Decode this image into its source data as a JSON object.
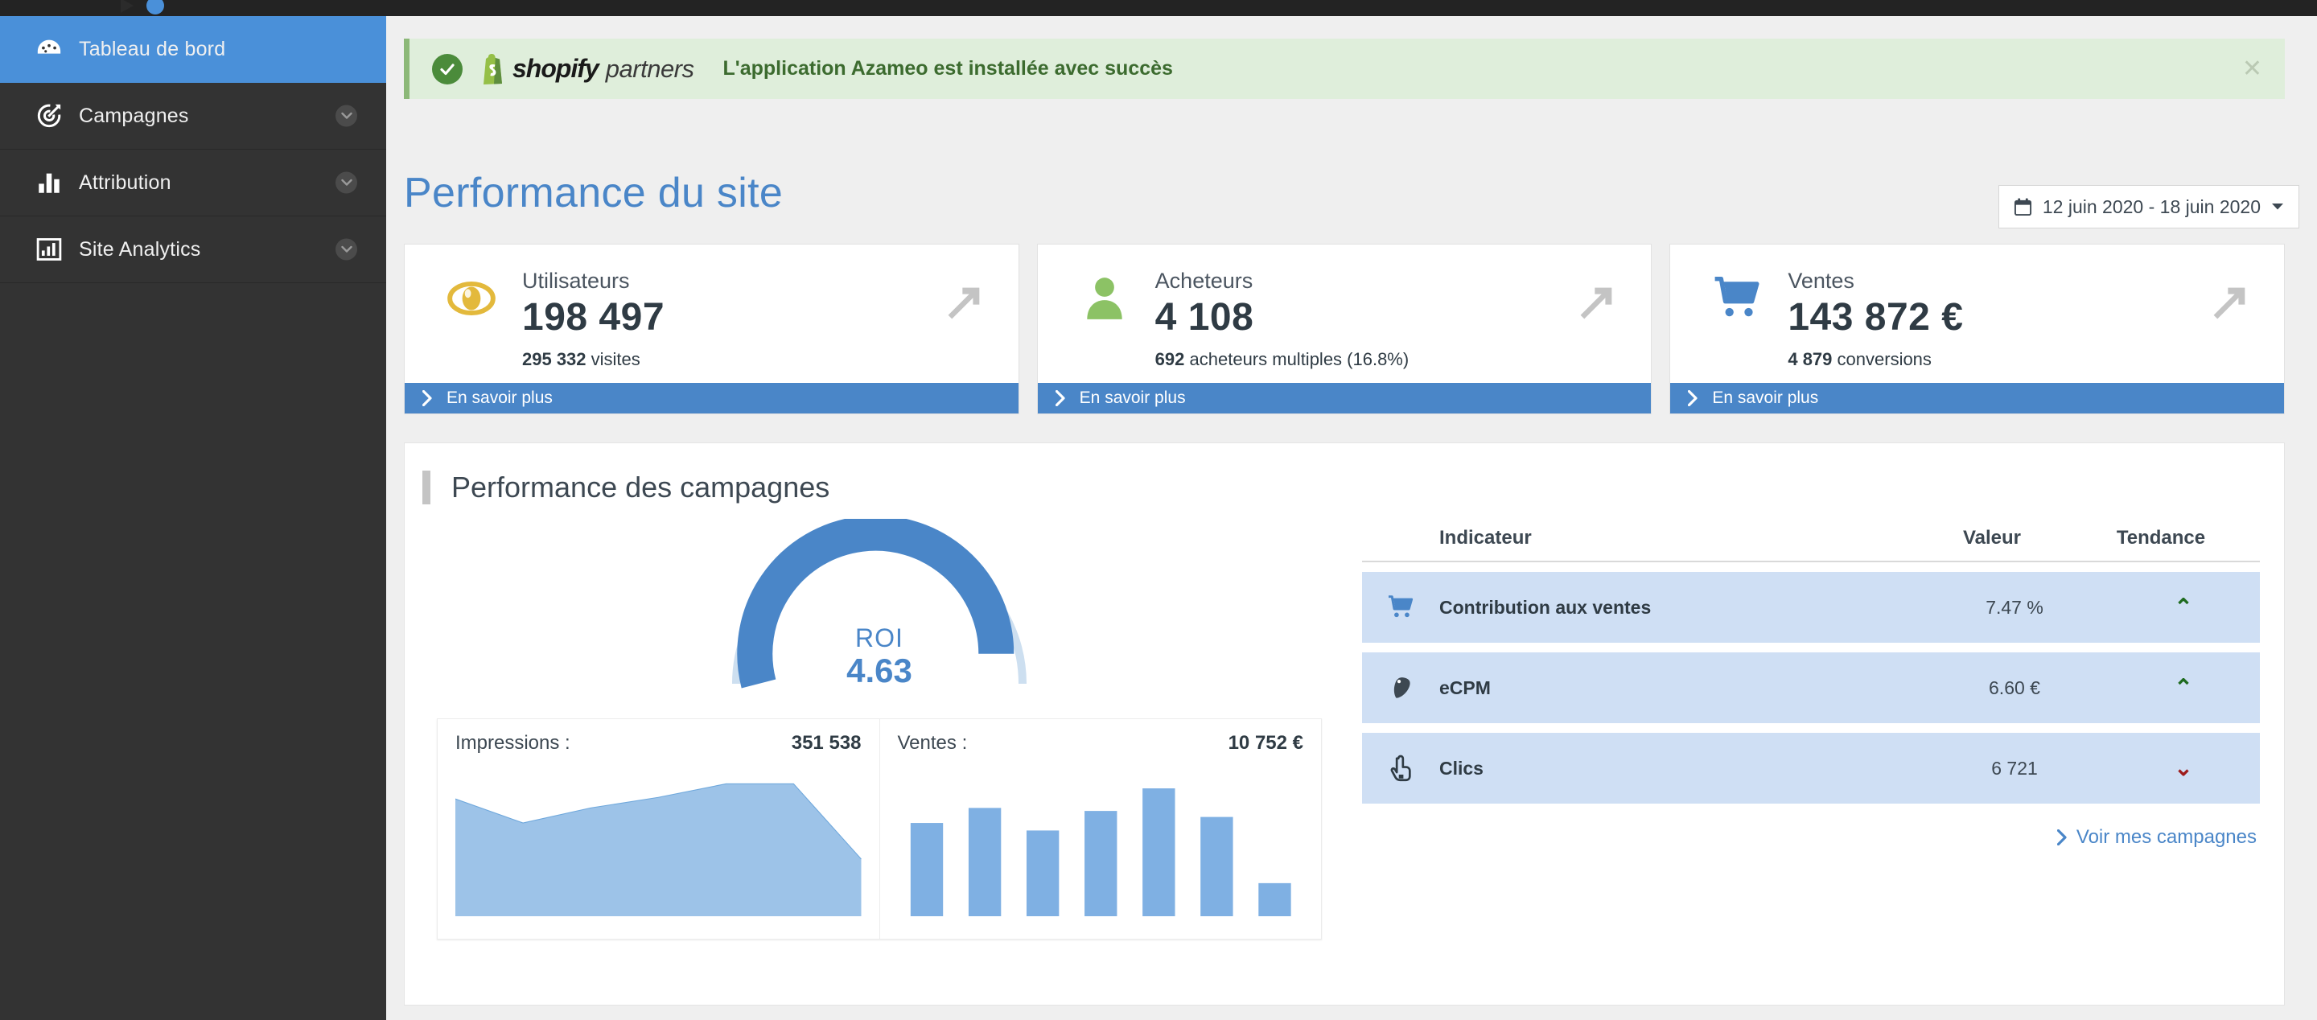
{
  "sidebar": {
    "items": [
      {
        "label": "Tableau de bord",
        "icon": "dashboard-gauge-icon",
        "active": true,
        "has_chevron": false
      },
      {
        "label": "Campagnes",
        "icon": "target-arrow-icon",
        "active": false,
        "has_chevron": true
      },
      {
        "label": "Attribution",
        "icon": "bar-chart-icon",
        "active": false,
        "has_chevron": true
      },
      {
        "label": "Site Analytics",
        "icon": "analytics-box-icon",
        "active": false,
        "has_chevron": true
      }
    ]
  },
  "banner": {
    "brand_primary": "shopify",
    "brand_secondary": "partners",
    "message": "L'application Azameo est installée avec succès",
    "close_label": "✕",
    "accent": "#8cb878",
    "background": "#dfeedb",
    "text_color": "#3c6b2f"
  },
  "header": {
    "title": "Performance du site",
    "date_range": "12 juin 2020 - 18 juin 2020",
    "title_color": "#4a86c8"
  },
  "cards": [
    {
      "label": "Utilisateurs",
      "value": "198 497",
      "sub_strong": "295 332",
      "sub_rest": "visites",
      "icon": "eye-icon",
      "icon_color": "#e3b93c",
      "trend": "up",
      "cta": "En savoir plus"
    },
    {
      "label": "Acheteurs",
      "value": "4 108",
      "sub_strong": "692",
      "sub_rest": "acheteurs multiples (16.8%)",
      "icon": "person-icon",
      "icon_color": "#8cc265",
      "trend": "up",
      "cta": "En savoir plus"
    },
    {
      "label": "Ventes",
      "value": "143 872 €",
      "sub_strong": "4 879",
      "sub_rest": "conversions",
      "icon": "cart-icon",
      "icon_color": "#4a86c8",
      "trend": "up",
      "cta": "En savoir plus"
    }
  ],
  "panel": {
    "title": "Performance des campagnes",
    "gauge": {
      "caption": "ROI",
      "value": "4.63",
      "fill_fraction": 0.92,
      "track_color": "#cddff0",
      "fill_color": "#4a86c8"
    },
    "table": {
      "headers": {
        "indicator": "Indicateur",
        "value": "Valeur",
        "trend": "Tendance"
      },
      "rows": [
        {
          "name": "Contribution aux ventes",
          "value": "7.47 %",
          "trend": "up",
          "icon": "cart-icon",
          "icon_color": "#4a86c8"
        },
        {
          "name": "eCPM",
          "value": "6.60 €",
          "trend": "up",
          "icon": "tag-icon",
          "icon_color": "#3d4852"
        },
        {
          "name": "Clics",
          "value": "6 721",
          "trend": "down",
          "icon": "click-hand-icon",
          "icon_color": "#2f3b44"
        }
      ],
      "row_background": "#cfdff4",
      "up_color": "#1f6b1f",
      "down_color": "#9e1b1b"
    },
    "see_all_link": "Voir mes campagnes"
  },
  "chart_data": [
    {
      "type": "area",
      "title": "Impressions :",
      "value_label": "351 538",
      "x": [
        0,
        1,
        2,
        3,
        4,
        5,
        6
      ],
      "values": [
        78,
        62,
        72,
        79,
        88,
        88,
        38
      ],
      "ylim": [
        0,
        100
      ],
      "grid": false,
      "color": "#9dc3e8",
      "line_color": "#6fa8dc"
    },
    {
      "type": "bar",
      "title": "Ventes :",
      "value_label": "10 752 €",
      "categories": [
        "1",
        "2",
        "3",
        "4",
        "5",
        "6",
        "7"
      ],
      "values": [
        62,
        72,
        57,
        70,
        85,
        66,
        22
      ],
      "ylim": [
        0,
        100
      ],
      "grid": false,
      "color": "#7fb0e3"
    }
  ]
}
